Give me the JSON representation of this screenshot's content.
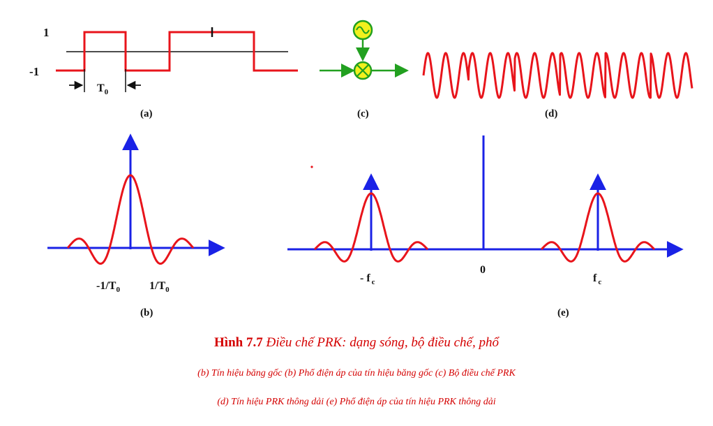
{
  "panels": {
    "a": {
      "label": "(a)",
      "level_high": "1",
      "level_low": "-1",
      "period_label": "T",
      "period_sub": "0"
    },
    "b": {
      "label": "(b)",
      "tick_left": "-1/T",
      "tick_left_sub": "0",
      "tick_right": "1/T",
      "tick_right_sub": "0"
    },
    "c": {
      "label": "(c)"
    },
    "d": {
      "label": "(d)"
    },
    "e": {
      "label": "(e)",
      "tick_left": "- f",
      "tick_left_sub": "c",
      "tick_center": "0",
      "tick_right": "f",
      "tick_right_sub": "c"
    }
  },
  "caption": {
    "prefix": "Hình 7.7",
    "text": "Điều chế PRK: dạng sóng, bộ điều chế, phổ",
    "line1": "(b)   Tín hiệu băng gốc    (b) Phổ điện áp của tín hiệu băng gốc    (c) Bộ điều chế PRK",
    "line2": "(d) Tín hiệu PRK thông dải    (e) Phổ điện áp của tín hiệu PRK thông dải"
  },
  "colors": {
    "signal": "#e8141b",
    "axis": "#1a22e6",
    "modulator": "#22a020",
    "oscillator_fill": "#f2f01e",
    "caption": "#d40000"
  }
}
